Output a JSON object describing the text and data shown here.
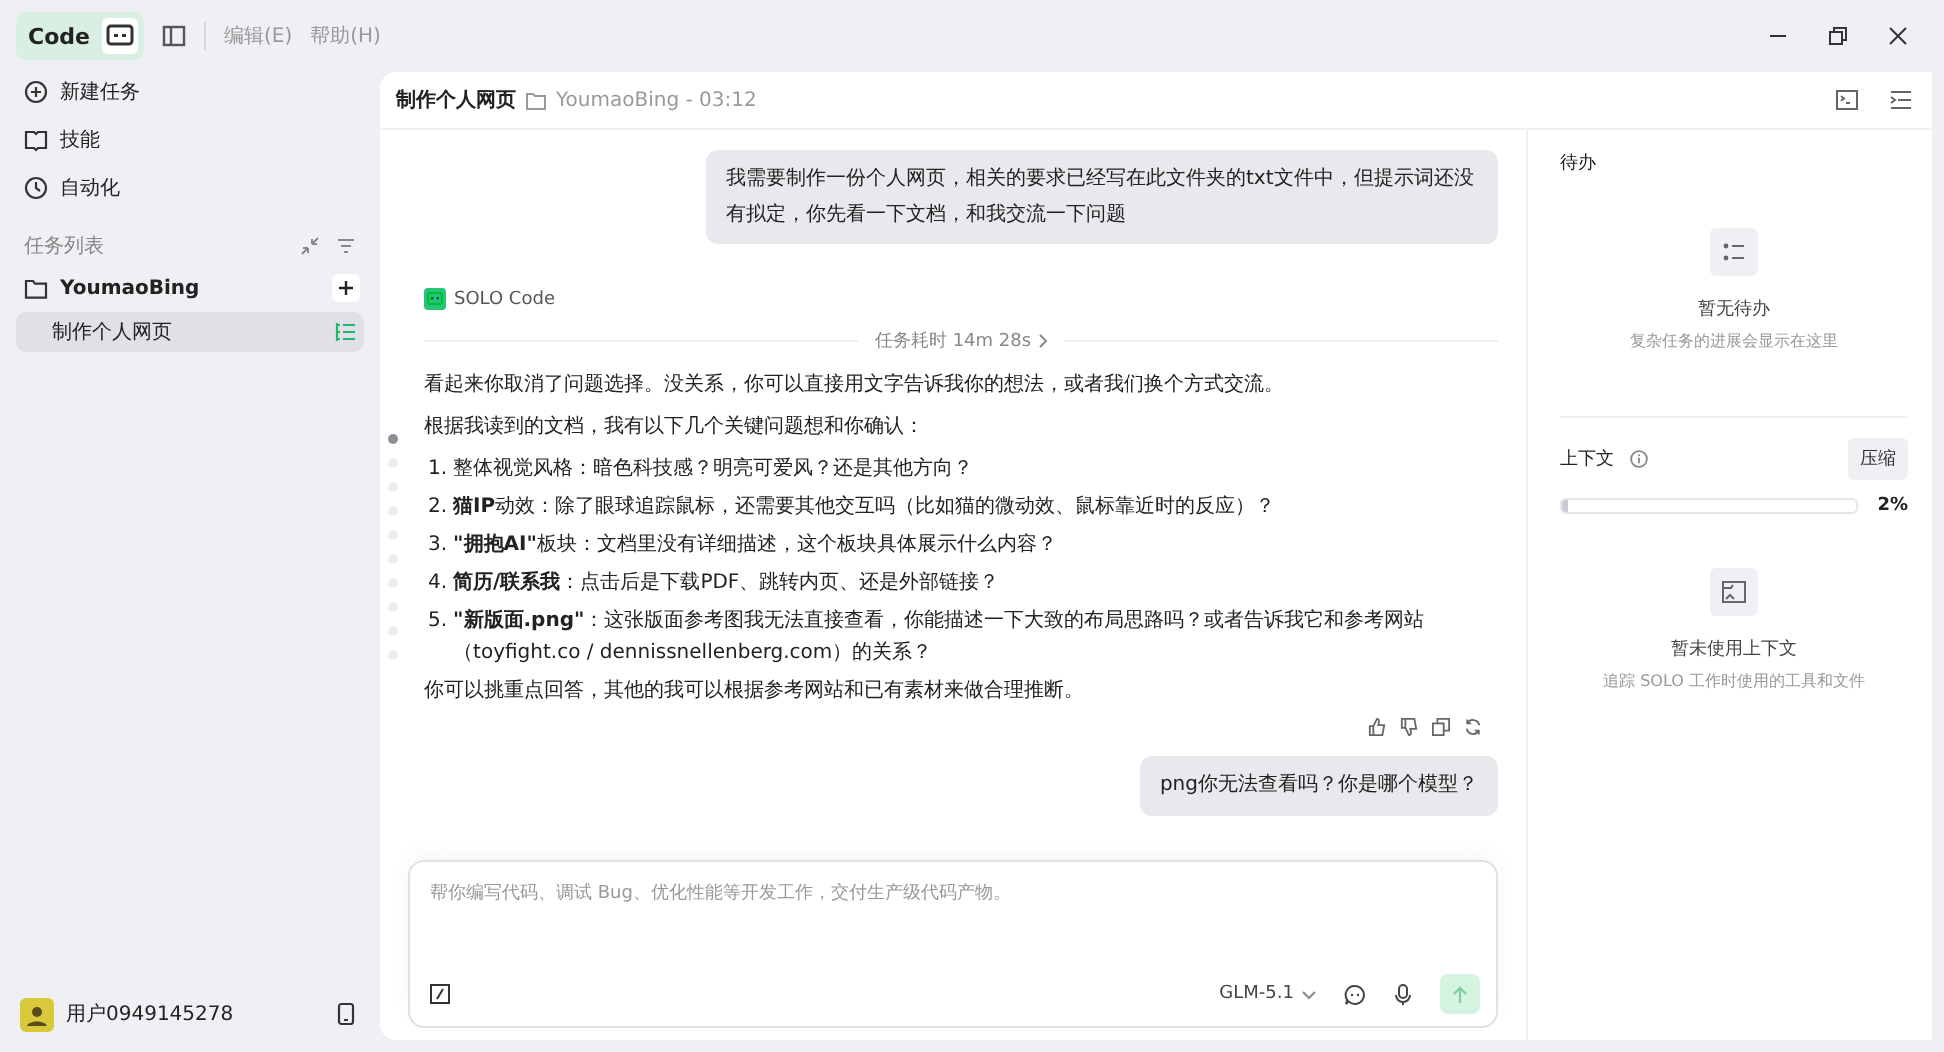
{
  "titlebar": {
    "app_label": "Code",
    "menus": [
      "编辑(E)",
      "帮助(H)"
    ]
  },
  "sidebar": {
    "nav": [
      {
        "kind": "new",
        "label": "新建任务"
      },
      {
        "kind": "skills",
        "label": "技能"
      },
      {
        "kind": "auto",
        "label": "自动化"
      }
    ],
    "section_title": "任务列表",
    "project": {
      "name": "YoumaoBing",
      "tasks": [
        {
          "label": "制作个人网页",
          "selected": true
        }
      ]
    },
    "user": "用户0949145278"
  },
  "header": {
    "title": "制作个人网页",
    "path": "YoumaoBing - 03:12"
  },
  "messages": [
    {
      "kind": "user",
      "text": "我需要制作一份个人网页，相关的要求已经写在此文件夹的txt文件中，但提示词还没有拟定，你先看一下文档，和我交流一下问题"
    },
    {
      "kind": "agent",
      "agent": "SOLO Code",
      "duration": "任务耗时 14m 28s",
      "intro": "看起来你取消了问题选择。没关系，你可以直接用文字告诉我你的想法，或者我们换个方式交流。",
      "lead": "根据我读到的文档，我有以下几个关键问题想和你确认：",
      "items": [
        {
          "number": "1.",
          "text": "整体视觉风格：暗色科技感？明亮可爱风？还是其他方向？"
        },
        {
          "number": "2.",
          "text": "**猫IP**动效：除了眼球追踪鼠标，还需要其他交互吗（比如猫的微动效、鼠标靠近时的反应）？"
        },
        {
          "number": "3.",
          "text": "**\"拥抱AI\"**板块：文档里没有详细描述，这个板块具体展示什么内容？"
        },
        {
          "number": "4.",
          "text": "**简历/联系我**：点击后是下载PDF、跳转内页、还是外部链接？"
        },
        {
          "number": "5.",
          "text": "**\"新版面.png\"**：这张版面参考图我无法直接查看，你能描述一下大致的布局思路吗？或者告诉我它和参考网站（toyfight.co / dennissnellenberg.com）的关系？"
        }
      ],
      "outro": "你可以挑重点回答，其他的我可以根据参考网站和已有素材来做合理推断。"
    },
    {
      "kind": "user",
      "text": "png你无法查看吗？你是哪个模型？"
    }
  ],
  "nav_dots": [
    {
      "selected": true
    },
    {
      "selected": false
    },
    {
      "selected": false
    },
    {
      "selected": false
    },
    {
      "selected": false
    },
    {
      "selected": false
    },
    {
      "selected": false
    },
    {
      "selected": false
    },
    {
      "selected": false
    },
    {
      "selected": false
    }
  ],
  "composer": {
    "placeholder": "帮你编写代码、调试 Bug、优化性能等开发工作，交付生产级代码产物。",
    "model": "GLM-5.1"
  },
  "todo": {
    "title": "待办",
    "empty_title": "暂无待办",
    "empty_hint": "复杂任务的进展会显示在这里"
  },
  "context": {
    "title": "上下文",
    "compress": "压缩",
    "level": 0.02,
    "percent": "2%",
    "empty_title": "暂未使用上下文",
    "empty_hint": "追踪 SOLO 工作时使用的工具和文件"
  }
}
